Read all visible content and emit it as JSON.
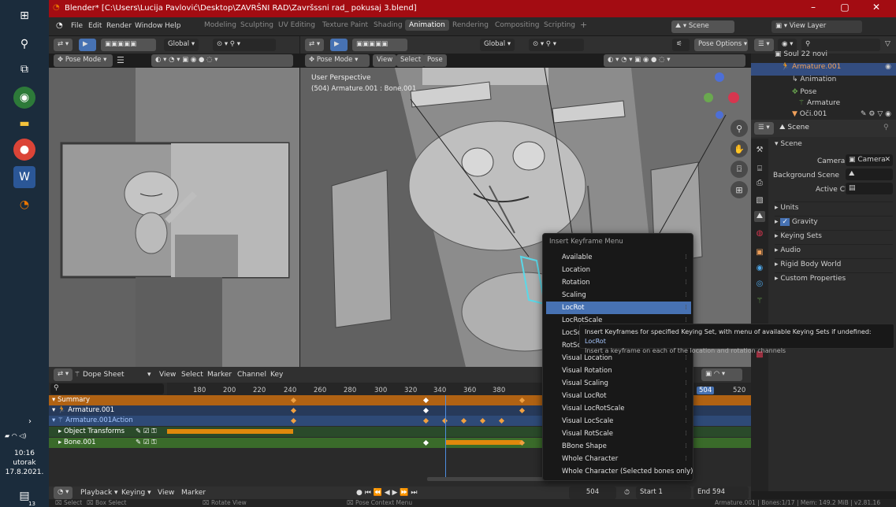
{
  "window": {
    "title": "Blender* [C:\\Users\\Lucija Pavlović\\Desktop\\ZAVRŠNI RAD\\Završssni rad_ pokusaj 3.blend]",
    "minimize": "–",
    "maximize": "▢",
    "close": "✕"
  },
  "taskbar": {
    "time": "10:16",
    "day": "utorak",
    "date": "17.8.2021.",
    "badge": "13"
  },
  "menubar": {
    "items": [
      "File",
      "Edit",
      "Render",
      "Window",
      "Help"
    ]
  },
  "workspaces": [
    {
      "label": "Modeling"
    },
    {
      "label": "Sculpting"
    },
    {
      "label": "UV Editing"
    },
    {
      "label": "Texture Paint"
    },
    {
      "label": "Shading"
    },
    {
      "label": "Animation"
    },
    {
      "label": "Rendering"
    },
    {
      "label": "Compositing"
    },
    {
      "label": "Scripting"
    },
    {
      "label": "+"
    }
  ],
  "scene": {
    "label": "Scene",
    "view_layer": "View Layer"
  },
  "viewport_left": {
    "transform": "Global",
    "mode": "Pose Mode"
  },
  "viewport_main": {
    "transform": "Global",
    "mode": "Pose Mode",
    "menus": [
      "View",
      "Select",
      "Pose"
    ],
    "pose_options": "Pose Options",
    "overlay_title": "User Perspective",
    "overlay_object": "(504) Armature.001 : Bone.001"
  },
  "outliner": {
    "search_placeholder": "",
    "rows": [
      "Soul 22 novi",
      "Armature.001",
      "Animation",
      "Pose",
      "Armature",
      "Oči.001"
    ]
  },
  "properties": {
    "context": "Scene",
    "panel": "Scene",
    "camera_label": "Camera",
    "camera_value": "Camera",
    "bg_scene_label": "Background Scene",
    "active_clip_label": "Active Clip",
    "sections": [
      "Units",
      "Gravity",
      "Keying Sets",
      "Audio",
      "Rigid Body World",
      "Custom Properties"
    ]
  },
  "dopesheet": {
    "mode": "Dope Sheet",
    "menus": [
      "View",
      "Select",
      "Marker",
      "Channel",
      "Key"
    ],
    "ticks": [
      "180",
      "200",
      "220",
      "240",
      "260",
      "280",
      "300",
      "320",
      "340",
      "360",
      "380",
      "504",
      "520"
    ],
    "current_frame": "504",
    "channels": [
      "Summary",
      "Armature.001",
      "Armature.001Action",
      "Object Transforms",
      "Bone.001"
    ]
  },
  "keyframe_menu": {
    "title": "Insert Keyframe Menu",
    "items": [
      "Available",
      "Location",
      "Rotation",
      "Scaling",
      "LocRot",
      "LocRotScale",
      "LocScale",
      "RotScale",
      "Visual Location",
      "Visual Rotation",
      "Visual Scaling",
      "Visual LocRot",
      "Visual LocRotScale",
      "Visual LocScale",
      "Visual RotScale",
      "BBone Shape",
      "Whole Character",
      "Whole Character (Selected bones only)"
    ],
    "highlighted_index": 4
  },
  "tooltip": {
    "line1": "Insert Keyframes for specified Keying Set, with menu of available Keying Sets if undefined:",
    "line1_value": "LocRot",
    "line2": "Insert a keyframe on each of the location and rotation channels"
  },
  "timeline": {
    "playback": "Playback",
    "keying": "Keying",
    "view": "View",
    "marker": "Marker",
    "frame": "504",
    "start_label": "Start",
    "start": "1",
    "end_label": "End",
    "end": "594"
  },
  "statusbar": {
    "select": "Select",
    "box_select": "Box Select",
    "rotate": "Rotate View",
    "context": "Pose Context Menu",
    "info": "Armature.001 | Bones:1/17 | Mem: 149.2 MiB | v2.81.16"
  }
}
